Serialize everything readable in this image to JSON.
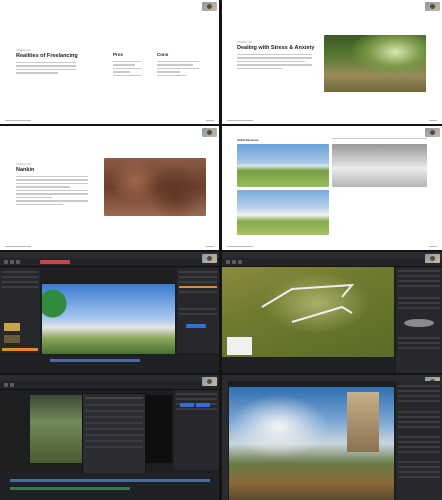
{
  "slides": {
    "freelancing": {
      "eyebrow": "Chapter 01",
      "title": "Realities of Freelancing",
      "pros_heading": "Pros",
      "cons_heading": "Cons"
    },
    "stress": {
      "eyebrow": "Chapter 02",
      "title": "Dealing with Stress & Anxiety"
    },
    "nankin": {
      "eyebrow": "Chapter 03",
      "title": "Nankin"
    },
    "gallery": {
      "label": "Initial Blockout"
    }
  },
  "icons": [
    "webcam-thumbnail"
  ],
  "colors": {
    "accent": "#e8862a",
    "selection": "#2f6fd6",
    "panel": "#27282b"
  }
}
